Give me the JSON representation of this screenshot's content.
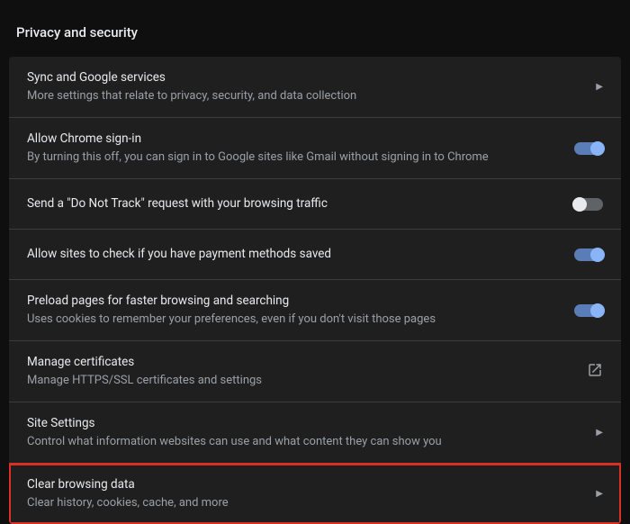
{
  "section_title": "Privacy and security",
  "rows": [
    {
      "title": "Sync and Google services",
      "subtitle": "More settings that relate to privacy, security, and data collection"
    },
    {
      "title": "Allow Chrome sign-in",
      "subtitle": "By turning this off, you can sign in to Google sites like Gmail without signing in to Chrome"
    },
    {
      "title": "Send a \"Do Not Track\" request with your browsing traffic"
    },
    {
      "title": "Allow sites to check if you have payment methods saved"
    },
    {
      "title": "Preload pages for faster browsing and searching",
      "subtitle": "Uses cookies to remember your preferences, even if you don't visit those pages"
    },
    {
      "title": "Manage certificates",
      "subtitle": "Manage HTTPS/SSL certificates and settings"
    },
    {
      "title": "Site Settings",
      "subtitle": "Control what information websites can use and what content they can show you"
    },
    {
      "title": "Clear browsing data",
      "subtitle": "Clear history, cookies, cache, and more"
    }
  ]
}
